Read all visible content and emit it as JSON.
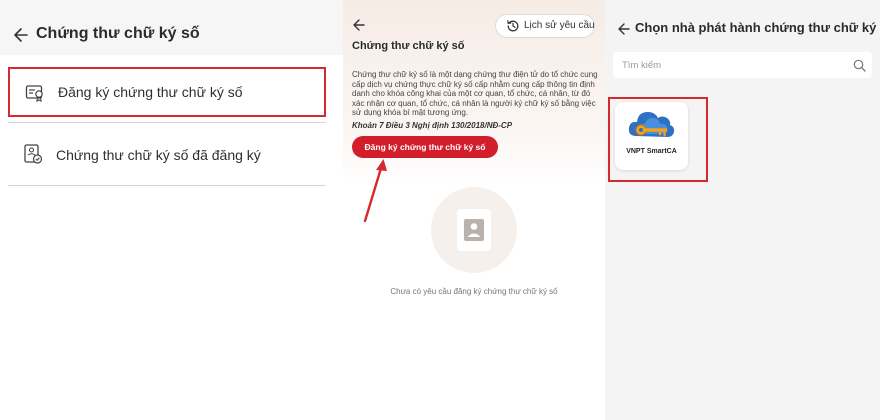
{
  "panel1": {
    "title": "Chứng thư chữ ký số",
    "items": [
      {
        "label": "Đăng ký chứng thư chữ ký số",
        "icon": "certificate-icon"
      },
      {
        "label": "Chứng thư chữ ký số đã đăng ký",
        "icon": "verified-document-icon"
      }
    ]
  },
  "panel2": {
    "history_label": "Lịch sử yêu cầu",
    "title": "Chứng thư chữ ký số",
    "description": "Chứng thư chữ ký số là một dạng chứng thư điện tử do tổ chức cung cấp dịch vụ chứng thực chữ ký số cấp nhằm cung cấp thông tin định danh cho khóa công khai của một cơ quan, tổ chức, cá nhân, từ đó xác nhận cơ quan, tổ chức, cá nhân là người ký chữ ký số bằng việc sử dụng khóa bí mật tương ứng.",
    "legal_ref": "Khoản 7 Điều 3 Nghị định 130/2018/NĐ-CP",
    "register_button": "Đăng ký chứng thư chữ ký số",
    "empty_text": "Chưa có yêu cầu đăng ký chứng thư chữ ký số"
  },
  "panel3": {
    "title": "Chọn nhà phát hành chứng thư chữ ký số",
    "search_placeholder": "Tìm kiếm",
    "providers": [
      {
        "name": "VNPT SmartCA",
        "icon": "vnpt-smartca-logo"
      }
    ]
  },
  "colors": {
    "accent_red": "#d21e2b",
    "highlight_red": "#d42a2e"
  }
}
